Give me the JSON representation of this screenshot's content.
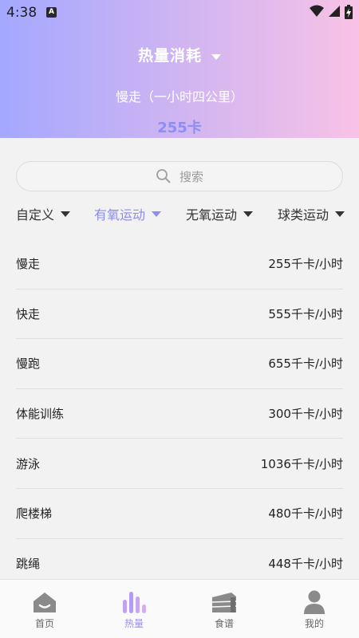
{
  "status_bar": {
    "time": "4:38",
    "notification_badge": "A"
  },
  "header": {
    "title": "热量消耗",
    "selected_activity": "慢走（一小时四公里）",
    "calories": "255卡"
  },
  "search": {
    "placeholder": "搜索"
  },
  "categories": [
    {
      "label": "自定义",
      "active": false
    },
    {
      "label": "有氧运动",
      "active": true
    },
    {
      "label": "无氧运动",
      "active": false
    },
    {
      "label": "球类运动",
      "active": false
    }
  ],
  "activities": [
    {
      "name": "慢走",
      "value": "255千卡/小时"
    },
    {
      "name": "快走",
      "value": "555千卡/小时"
    },
    {
      "name": "慢跑",
      "value": "655千卡/小时"
    },
    {
      "name": "体能训练",
      "value": "300千卡/小时"
    },
    {
      "name": "游泳",
      "value": "1036千卡/小时"
    },
    {
      "name": "爬楼梯",
      "value": "480千卡/小时"
    },
    {
      "name": "跳绳",
      "value": "448千卡/小时"
    }
  ],
  "tabs": [
    {
      "label": "首页",
      "icon": "home-icon",
      "active": false
    },
    {
      "label": "热量",
      "icon": "bar-chart-icon",
      "active": true
    },
    {
      "label": "食谱",
      "icon": "cake-icon",
      "active": false
    },
    {
      "label": "我的",
      "icon": "user-icon",
      "active": false
    }
  ],
  "colors": {
    "accent": "#8a8cf0",
    "header_gradient_start": "#a4a8ff",
    "header_gradient_end": "#f8c2e6",
    "calorie_text": "#8c8ef5",
    "tab_active": "#9b8df0"
  }
}
